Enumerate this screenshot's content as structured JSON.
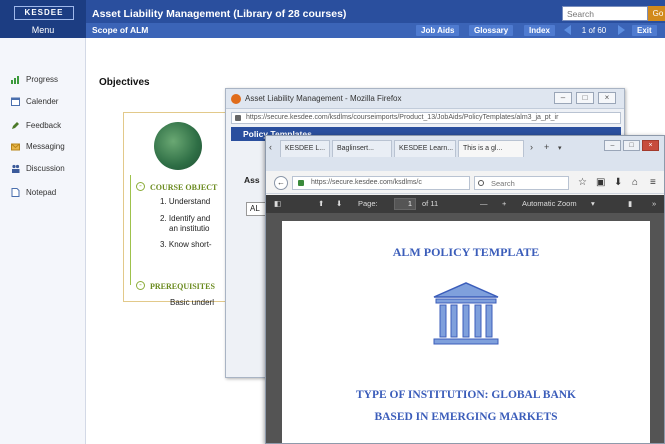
{
  "app": {
    "logo": "KESDEE",
    "title": "Asset Liability Management (Library of 28 courses)",
    "menu_label": "Menu",
    "search_placeholder": "Search",
    "go_label": "Go",
    "scope": "Scope of ALM",
    "nav": {
      "job_aids": "Job Aids",
      "glossary": "Glossary",
      "index": "Index",
      "page_counter": "1 of 60",
      "exit": "Exit"
    }
  },
  "sidebar": {
    "items": [
      {
        "label": "Progress",
        "icon": "progress-chart-icon"
      },
      {
        "label": "Calender",
        "icon": "calendar-icon"
      },
      {
        "label": "Feedback",
        "icon": "pencil-icon"
      },
      {
        "label": "Messaging",
        "icon": "envelope-icon"
      },
      {
        "label": "Discussion",
        "icon": "people-icon"
      },
      {
        "label": "Notepad",
        "icon": "document-icon"
      }
    ]
  },
  "content": {
    "heading": "Objectives",
    "course_objectives": "COURSE OBJECT",
    "objectives": [
      "1.  Understand",
      "2.  Identify and",
      "an institutio",
      "3.  Know short-"
    ],
    "prerequisites": "PREREQUISITES",
    "prereq_text": "Basic underl"
  },
  "firefox": {
    "title": "Asset Liability Management - Mozilla Firefox",
    "url": "https://secure.kesdee.com/ksdlms/courseimports/Product_13/JobAids/PolicyTemplates/alm3_ja_pt_ir",
    "policy_bar": "Policy Templates",
    "ass_label": "Ass",
    "al_box": "AL"
  },
  "browser": {
    "tabs": [
      {
        "label": "KESDEE L..."
      },
      {
        "label": "Baglinsert..."
      },
      {
        "label": "KESDEE Learn..."
      },
      {
        "label": "This is a gl..."
      }
    ],
    "url": "https://secure.kesdee.com/ksdlms/c",
    "search_placeholder": "Search",
    "pdf": {
      "page_label": "Page:",
      "page_value": "1",
      "page_total": "of 11",
      "zoom": "Automatic Zoom",
      "title": "ALM POLICY TEMPLATE",
      "line1": "TYPE OF INSTITUTION: GLOBAL BANK",
      "line2": "BASED IN EMERGING MARKETS"
    }
  },
  "colors": {
    "lms_blue": "#2a4f9e",
    "accent_orange": "#d28a1c",
    "tree_green": "#8cad3a",
    "pdf_text_blue": "#3b5dba"
  }
}
